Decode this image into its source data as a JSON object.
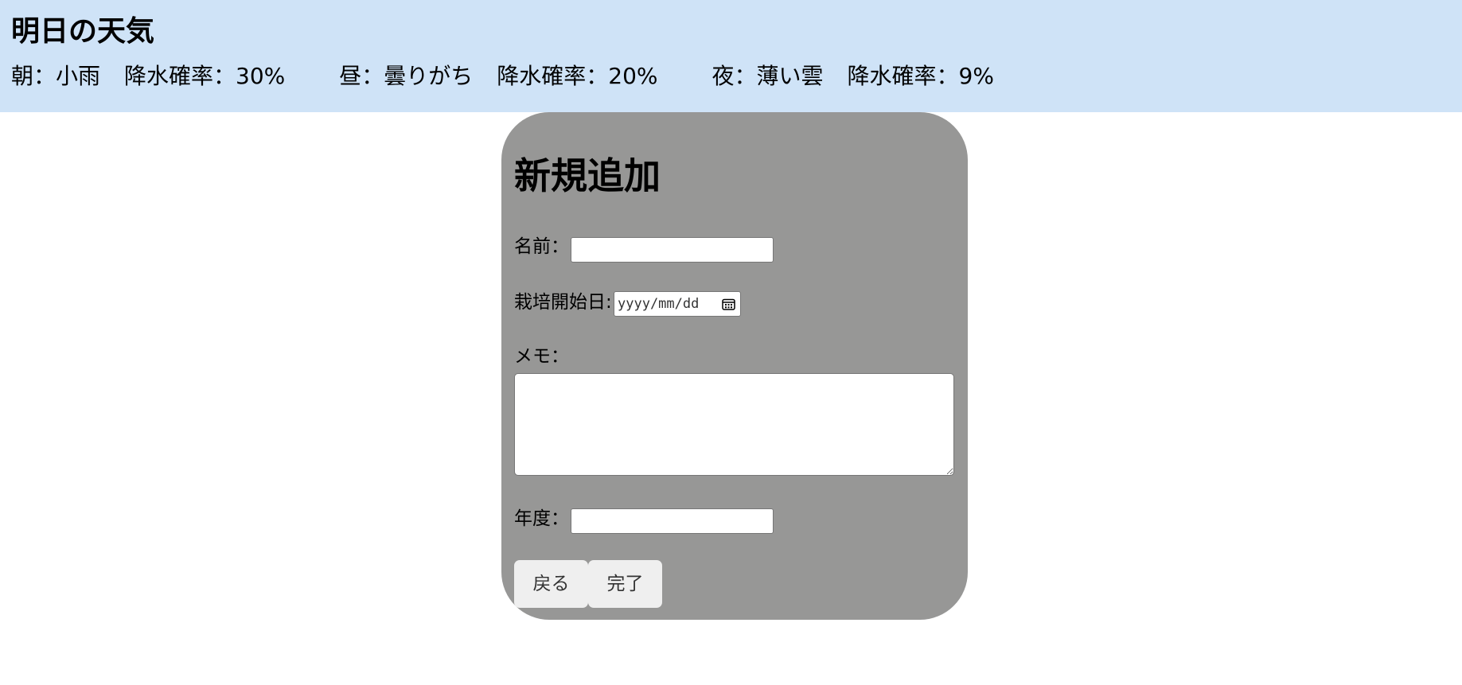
{
  "weather": {
    "title": "明日の天気",
    "morning": {
      "label": "朝：小雨",
      "rain": "降水確率：30%"
    },
    "noon": {
      "label": "昼：曇りがち",
      "rain": "降水確率：20%"
    },
    "night": {
      "label": "夜：薄い雲",
      "rain": "降水確率：9%"
    }
  },
  "form": {
    "title": "新規追加",
    "name_label": "名前：",
    "name_value": "",
    "start_date_label": "栽培開始日:",
    "start_date_placeholder": "yyyy/mm/dd",
    "memo_label": "メモ：",
    "memo_value": "",
    "year_label": "年度：",
    "year_value": "",
    "back_label": "戻る",
    "done_label": "完了"
  },
  "colors": {
    "banner_bg": "#cfe3f7",
    "card_bg": "#979796",
    "button_bg": "#efefef"
  },
  "icons": {
    "date_picker": "calendar-icon"
  }
}
